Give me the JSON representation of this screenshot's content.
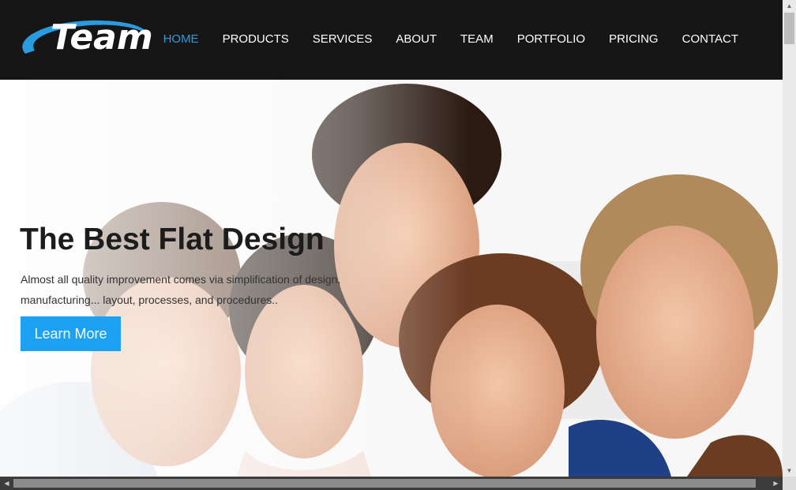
{
  "brand": {
    "logo_text": "Team",
    "accent": "#2b9be0"
  },
  "nav": {
    "items": [
      {
        "label": "HOME",
        "active": true
      },
      {
        "label": "PRODUCTS"
      },
      {
        "label": "SERVICES"
      },
      {
        "label": "ABOUT"
      },
      {
        "label": "TEAM"
      },
      {
        "label": "PORTFOLIO"
      },
      {
        "label": "PRICING"
      },
      {
        "label": "CONTACT"
      }
    ]
  },
  "hero": {
    "title": "The Best Flat Design",
    "text_line1": "Almost all quality improvement comes via simplification of design,",
    "text_line2": "manufacturing... layout, processes, and procedures..",
    "button_label": "Learn More",
    "button_color": "#1da1f2",
    "image": "group-of-smiling-friends-photo"
  },
  "scrollbars": {
    "up_icon": "scroll-up-arrow-icon",
    "down_icon": "scroll-down-arrow-icon",
    "left_icon": "scroll-left-arrow-icon",
    "right_icon": "scroll-right-arrow-icon"
  }
}
